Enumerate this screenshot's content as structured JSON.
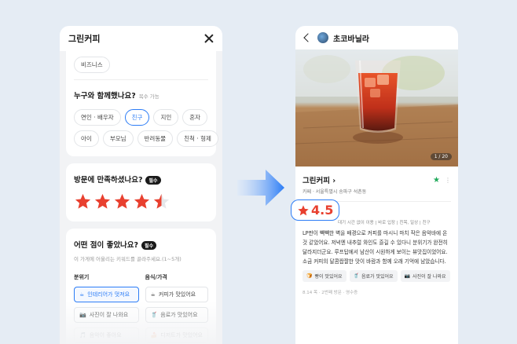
{
  "left": {
    "title": "그린커피",
    "top_chip": "비즈니스",
    "who_question": "누구와 함께했나요?",
    "who_sub": "복수 가능",
    "who_chips_row1": [
      "연인 · 배우자",
      "친구",
      "지인",
      "혼자"
    ],
    "who_chips_row2": [
      "아이",
      "부모님",
      "반려동물",
      "친척 · 형제"
    ],
    "who_selected": "친구",
    "satisfaction_question": "방문에 만족하셨나요?",
    "required": "필수",
    "rating": 4.5,
    "points_question": "어떤 점이 좋았나요?",
    "points_required": "필수",
    "points_hint": "이 가게에 어울리는 키워드를 골라주세요.(1~5개)",
    "col1_head": "분위기",
    "col2_head": "음식/가격",
    "col1_items": [
      {
        "icon": "☕",
        "label": "인테리어가 멋져요",
        "selected": true
      },
      {
        "icon": "📷",
        "label": "사진이 잘 나와요"
      },
      {
        "icon": "🎵",
        "label": "음악이 좋아요"
      }
    ],
    "col2_items": [
      {
        "icon": "☕",
        "label": "커피가 맛있어요"
      },
      {
        "icon": "🥤",
        "label": "음료가 맛있어요"
      },
      {
        "icon": "🍰",
        "label": "디저트가 맛있어요"
      }
    ]
  },
  "right": {
    "user": "초코바닐라",
    "photo_counter": "1 / 20",
    "place_name": "그린커피",
    "place_addr": "카페 · 서울특별시 송파구 석촌동",
    "rating_display": "4.5",
    "tags_line": "대기 시간 없이 이용 | 바로 입장 | 친목, 일상 | 친구",
    "review_text": "LP판이 빽빽한 벽을 배경으로 커피를 마시니 마치 작은 음악바에 온 것 같았어요. 저녁엔 내추럴 와인도 즐길 수 있다니 분위기가 완전히 달라지더군요. 루프탑에서 남산이 시원하게 보이는 뷰맛집이었어요. 소금 커피의 달콤짭짤한 맛이 바람과 함께 오래 기억에 남았습니다.",
    "review_tags": [
      {
        "icon": "🍞",
        "label": "빵이 맛있어요"
      },
      {
        "icon": "🥤",
        "label": "음료가 맛있어요"
      },
      {
        "icon": "📷",
        "label": "사진이 잘 나와요"
      }
    ],
    "meta": "8.14 목 · 2번째 방문 · 영수증"
  },
  "colors": {
    "accent_blue": "#2b7cf6",
    "star_red": "#e8402f",
    "green": "#1faa5a",
    "background": "#e5ecf4"
  }
}
